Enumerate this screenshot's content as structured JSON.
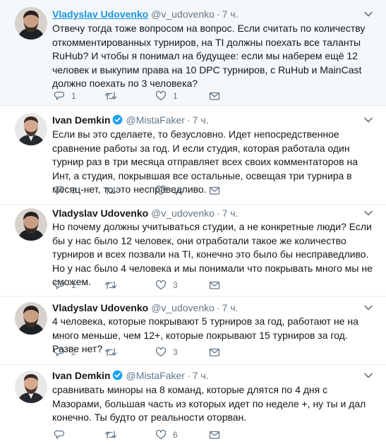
{
  "tweets": [
    {
      "author": "Vladyslav Udovenko",
      "handle": "@v_udovenko",
      "time": "7 ч.",
      "verified": false,
      "text": "Отвечу тогда тоже вопросом на вопрос. Если считать по количеству откомментированных турниров, на TI должны поехать все таланты RuHub? И чтобы я понимал на будущее: если мы наберем ещё 12 человек и выкупим права на 10 DPC турниров, с RuHub и MainCast должно поехать по 3 человека?",
      "replies": "1",
      "retweets": "",
      "likes": "1"
    },
    {
      "author": "Ivan Demkin",
      "handle": "@MistaFaker",
      "time": "7 ч.",
      "verified": true,
      "text": "Если вы это сделаете, то безусловно. Идет непосредственное сравнение работы за год. И если студия, которая работала один турнир раз в три месяца отправляет всех своих комментаторов на Инт, а студия, покрывшая все остальные, освещая три турнира в месяц-нет, то это несправедливо.",
      "replies": "2",
      "retweets": "",
      "likes": "18"
    },
    {
      "author": "Vladyslav Udovenko",
      "handle": "@v_udovenko",
      "time": "7 ч.",
      "verified": false,
      "text": "Но почему должны учитываться студии, а не конкретные люди? Если бы у нас было 12 человек, они отработали такое же количество турниров и всех позвали на TI, конечно это было бы несправедливо. Но у нас было 4 человека и мы понимали что покрывать много мы не сможем.",
      "replies": "1",
      "retweets": "",
      "likes": "3"
    },
    {
      "author": "Vladyslav Udovenko",
      "handle": "@v_udovenko",
      "time": "7 ч.",
      "verified": false,
      "text": "4 человека, которые покрывают 5 турниров за год, работают не на много меньше, чем 12+, которые покрывают 15 турниров за год. Разве нет?",
      "replies": "2",
      "retweets": "",
      "likes": "3"
    },
    {
      "author": "Ivan Demkin",
      "handle": "@MistaFaker",
      "time": "7 ч.",
      "verified": true,
      "text": "сравнивать миноры на 8 команд, которые длятся по 4 дня с Мазорами, большая часть из которых идет по неделе +, ну ты и дал конечно. Ты будто от реальности оторван.",
      "replies": "",
      "retweets": "",
      "likes": "6"
    }
  ],
  "colors": {
    "accent": "#1b95e0",
    "secondary_text": "#657786",
    "highlight_bg": "#f5f8fa",
    "divider": "#e6ecf0"
  },
  "icons": [
    "reply-icon",
    "retweet-icon",
    "like-icon",
    "direct-message-icon",
    "caret-down-icon",
    "verified-badge-icon"
  ]
}
